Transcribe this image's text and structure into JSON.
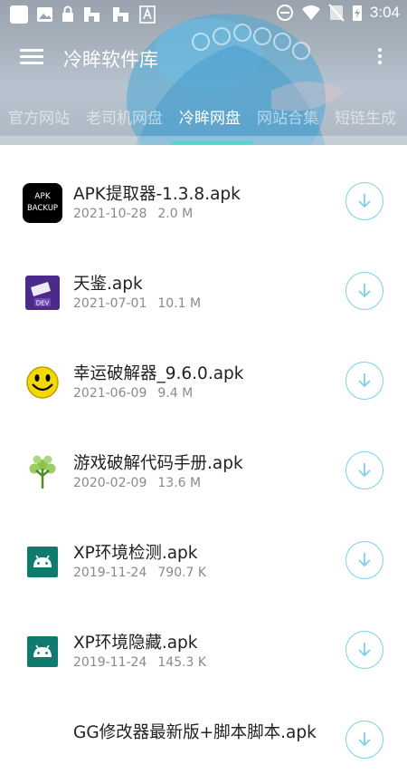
{
  "status_bar": {
    "time": "3:04"
  },
  "toolbar": {
    "title": "冷眸软件库"
  },
  "tabs": [
    {
      "label": "官方网站",
      "active": false
    },
    {
      "label": "老司机网盘",
      "active": false
    },
    {
      "label": "冷眸网盘",
      "active": true
    },
    {
      "label": "网站合集",
      "active": false
    },
    {
      "label": "短链生成",
      "active": false
    }
  ],
  "files": [
    {
      "name": "APK提取器-1.3.8.apk",
      "date": "2021-10-28",
      "size": "2.0 M",
      "icon": "apk-backup-icon",
      "icon_text": [
        "APK",
        "BACKUP"
      ]
    },
    {
      "name": "天鉴.apk",
      "date": "2021-07-01",
      "size": "10.1 M",
      "icon": "dev-icon",
      "icon_text": [
        "DEV"
      ]
    },
    {
      "name": "幸运破解器_9.6.0.apk",
      "date": "2021-06-09",
      "size": "9.4 M",
      "icon": "smiley-icon"
    },
    {
      "name": "游戏破解代码手册.apk",
      "date": "2020-02-09",
      "size": "13.6 M",
      "icon": "tree-icon"
    },
    {
      "name": "XP环境检测.apk",
      "date": "2019-11-24",
      "size": "790.7 K",
      "icon": "android-icon"
    },
    {
      "name": "XP环境隐藏.apk",
      "date": "2019-11-24",
      "size": "145.3 K",
      "icon": "android-icon"
    },
    {
      "name": "GG修改器最新版+脚本脚本.apk",
      "icon": "android-icon"
    }
  ],
  "colors": {
    "accent": "#58d3c8",
    "download_ring": "#7fd0e8"
  }
}
